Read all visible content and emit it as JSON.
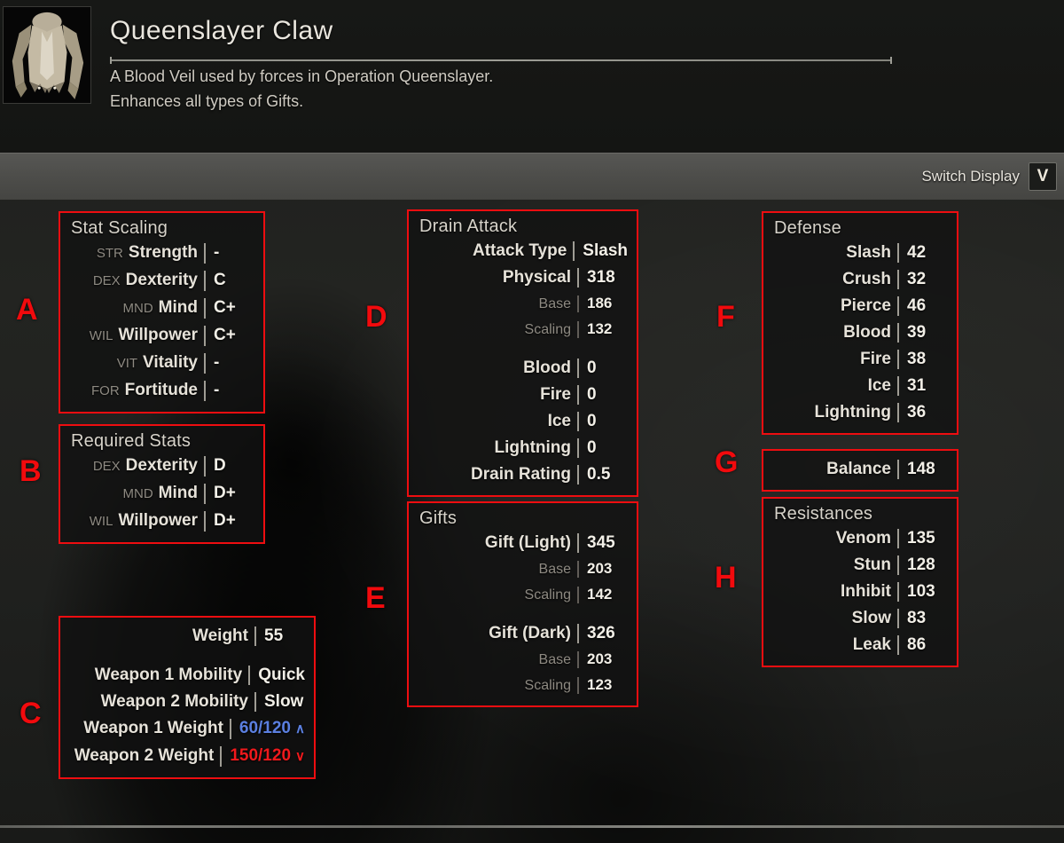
{
  "item": {
    "title": "Queenslayer Claw",
    "description_line1": "A Blood Veil used by forces in Operation Queenslayer.",
    "description_line2": "Enhances all types of Gifts.",
    "icon_name": "blood-veil-coat-icon"
  },
  "switch_display": {
    "label": "Switch Display",
    "key": "V"
  },
  "colors": {
    "annotation_red": "#f20a0d",
    "value_up_blue": "#5b7fe0",
    "value_down_red": "#f0191c",
    "panel_border": "#ee0d10",
    "bar_gray": "#4e4e4b"
  },
  "annotations": {
    "a": "A",
    "b": "B",
    "c": "C",
    "d": "D",
    "e": "E",
    "f": "F",
    "g": "G",
    "h": "H"
  },
  "stat_scaling": {
    "title": "Stat Scaling",
    "rows": [
      {
        "abbr": "STR",
        "label": "Strength",
        "value": "-"
      },
      {
        "abbr": "DEX",
        "label": "Dexterity",
        "value": "C"
      },
      {
        "abbr": "MND",
        "label": "Mind",
        "value": "C+"
      },
      {
        "abbr": "WIL",
        "label": "Willpower",
        "value": "C+"
      },
      {
        "abbr": "VIT",
        "label": "Vitality",
        "value": "-"
      },
      {
        "abbr": "FOR",
        "label": "Fortitude",
        "value": "-"
      }
    ]
  },
  "required_stats": {
    "title": "Required Stats",
    "rows": [
      {
        "abbr": "DEX",
        "label": "Dexterity",
        "value": "D"
      },
      {
        "abbr": "MND",
        "label": "Mind",
        "value": "D+"
      },
      {
        "abbr": "WIL",
        "label": "Willpower",
        "value": "D+"
      }
    ]
  },
  "weight_panel": {
    "weight_label": "Weight",
    "weight_value": "55",
    "rows": [
      {
        "label": "Weapon 1 Mobility",
        "value": "Quick",
        "state": "normal",
        "arrow": ""
      },
      {
        "label": "Weapon 2 Mobility",
        "value": "Slow",
        "state": "normal",
        "arrow": ""
      },
      {
        "label": "Weapon 1 Weight",
        "value": "60/120",
        "state": "up",
        "arrow": "∧"
      },
      {
        "label": "Weapon 2 Weight",
        "value": "150/120",
        "state": "down",
        "arrow": "∨"
      }
    ]
  },
  "drain_attack": {
    "title": "Drain Attack",
    "rows": [
      {
        "label": "Attack Type",
        "value": "Slash",
        "sub": false
      },
      {
        "label": "Physical",
        "value": "318",
        "sub": false
      },
      {
        "label": "Base",
        "value": "186",
        "sub": true
      },
      {
        "label": "Scaling",
        "value": "132",
        "sub": true
      },
      {
        "label": "Blood",
        "value": "0",
        "sub": false,
        "gap_before": true
      },
      {
        "label": "Fire",
        "value": "0",
        "sub": false
      },
      {
        "label": "Ice",
        "value": "0",
        "sub": false
      },
      {
        "label": "Lightning",
        "value": "0",
        "sub": false
      },
      {
        "label": "Drain Rating",
        "value": "0.5",
        "sub": false
      }
    ]
  },
  "gifts": {
    "title": "Gifts",
    "rows": [
      {
        "label": "Gift (Light)",
        "value": "345",
        "sub": false
      },
      {
        "label": "Base",
        "value": "203",
        "sub": true
      },
      {
        "label": "Scaling",
        "value": "142",
        "sub": true
      },
      {
        "label": "Gift (Dark)",
        "value": "326",
        "sub": false,
        "gap_before": true
      },
      {
        "label": "Base",
        "value": "203",
        "sub": true
      },
      {
        "label": "Scaling",
        "value": "123",
        "sub": true
      }
    ]
  },
  "defense": {
    "title": "Defense",
    "rows": [
      {
        "label": "Slash",
        "value": "42"
      },
      {
        "label": "Crush",
        "value": "32"
      },
      {
        "label": "Pierce",
        "value": "46"
      },
      {
        "label": "Blood",
        "value": "39"
      },
      {
        "label": "Fire",
        "value": "38"
      },
      {
        "label": "Ice",
        "value": "31"
      },
      {
        "label": "Lightning",
        "value": "36"
      }
    ]
  },
  "balance": {
    "label": "Balance",
    "value": "148"
  },
  "resistances": {
    "title": "Resistances",
    "rows": [
      {
        "label": "Venom",
        "value": "135"
      },
      {
        "label": "Stun",
        "value": "128"
      },
      {
        "label": "Inhibit",
        "value": "103"
      },
      {
        "label": "Slow",
        "value": "83"
      },
      {
        "label": "Leak",
        "value": "86"
      }
    ]
  }
}
